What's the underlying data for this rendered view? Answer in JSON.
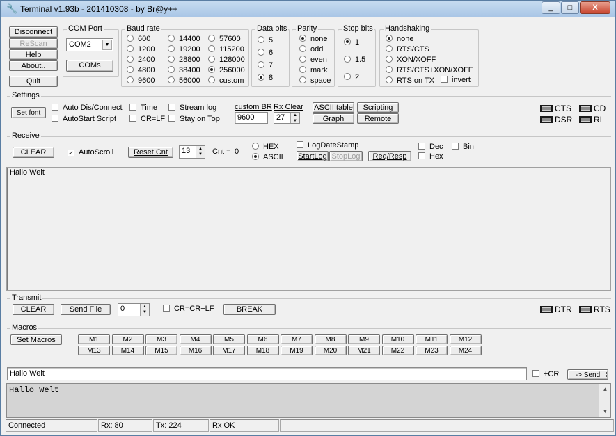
{
  "window": {
    "title": "Terminal v1.93b - 201410308 - by Br@y++",
    "min": "_",
    "max": "□",
    "close": "X"
  },
  "conn_buttons": {
    "disconnect": "Disconnect",
    "rescan": "ReScan",
    "help": "Help",
    "about": "About..",
    "quit": "Quit"
  },
  "com_port": {
    "label": "COM Port",
    "value": "COM2",
    "coms_button": "COMs"
  },
  "baud_rate": {
    "label": "Baud rate",
    "options": [
      "600",
      "1200",
      "2400",
      "4800",
      "9600",
      "14400",
      "19200",
      "28800",
      "38400",
      "56000",
      "57600",
      "115200",
      "128000",
      "256000",
      "custom"
    ],
    "selected": "256000"
  },
  "data_bits": {
    "label": "Data bits",
    "options": [
      "5",
      "6",
      "7",
      "8"
    ],
    "selected": "8"
  },
  "parity": {
    "label": "Parity",
    "options": [
      "none",
      "odd",
      "even",
      "mark",
      "space"
    ],
    "selected": "none"
  },
  "stop_bits": {
    "label": "Stop bits",
    "options": [
      "1",
      "1.5",
      "2"
    ],
    "selected": "1"
  },
  "handshaking": {
    "label": "Handshaking",
    "options": [
      "none",
      "RTS/CTS",
      "XON/XOFF",
      "RTS/CTS+XON/XOFF",
      "RTS on TX"
    ],
    "selected": "none",
    "invert": "invert"
  },
  "settings": {
    "label": "Settings",
    "set_font": "Set font",
    "auto_dis_connect": "Auto Dis/Connect",
    "autostart_script": "AutoStart Script",
    "time": "Time",
    "cr_lf": "CR=LF",
    "stream_log": "Stream log",
    "stay_on_top": "Stay on Top",
    "custom_br_label": "custom BR",
    "custom_br_value": "9600",
    "rx_clear_label": "Rx Clear",
    "rx_clear_value": "27",
    "ascii_table": "ASCII table",
    "graph": "Graph",
    "scripting": "Scripting",
    "remote": "Remote",
    "leds": {
      "cts": "CTS",
      "cd": "CD",
      "dsr": "DSR",
      "ri": "RI"
    }
  },
  "receive": {
    "label": "Receive",
    "clear": "CLEAR",
    "autoscroll": "AutoScroll",
    "reset_cnt": "Reset Cnt",
    "cnt_spin": "13",
    "cnt_label": "Cnt =",
    "cnt_value": "0",
    "hex": "HEX",
    "ascii": "ASCII",
    "logdatestamp": "LogDateStamp",
    "startlog": "StartLog",
    "stoplog": "StopLog",
    "req_resp": "Req/Resp",
    "dec": "Dec",
    "bin": "Bin",
    "hexchk": "Hex",
    "content": "Hallo Welt"
  },
  "transmit": {
    "label": "Transmit",
    "clear": "CLEAR",
    "send_file": "Send File",
    "spin": "0",
    "cr_cr_lf": "CR=CR+LF",
    "break": "BREAK",
    "leds": {
      "dtr": "DTR",
      "rts": "RTS"
    }
  },
  "macros": {
    "label": "Macros",
    "set_macros": "Set Macros",
    "row1": [
      "M1",
      "M2",
      "M3",
      "M4",
      "M5",
      "M6",
      "M7",
      "M8",
      "M9",
      "M10",
      "M11",
      "M12"
    ],
    "row2": [
      "M13",
      "M14",
      "M15",
      "M16",
      "M17",
      "M18",
      "M19",
      "M20",
      "M21",
      "M22",
      "M23",
      "M24"
    ]
  },
  "send": {
    "input_value": "Hallo Welt",
    "plus_cr": "+CR",
    "send_button": "-> Send"
  },
  "log": {
    "content": "Hallo Welt"
  },
  "status": {
    "connected": "Connected",
    "rx": "Rx: 80",
    "tx": "Tx: 224",
    "rx_ok": "Rx OK"
  }
}
